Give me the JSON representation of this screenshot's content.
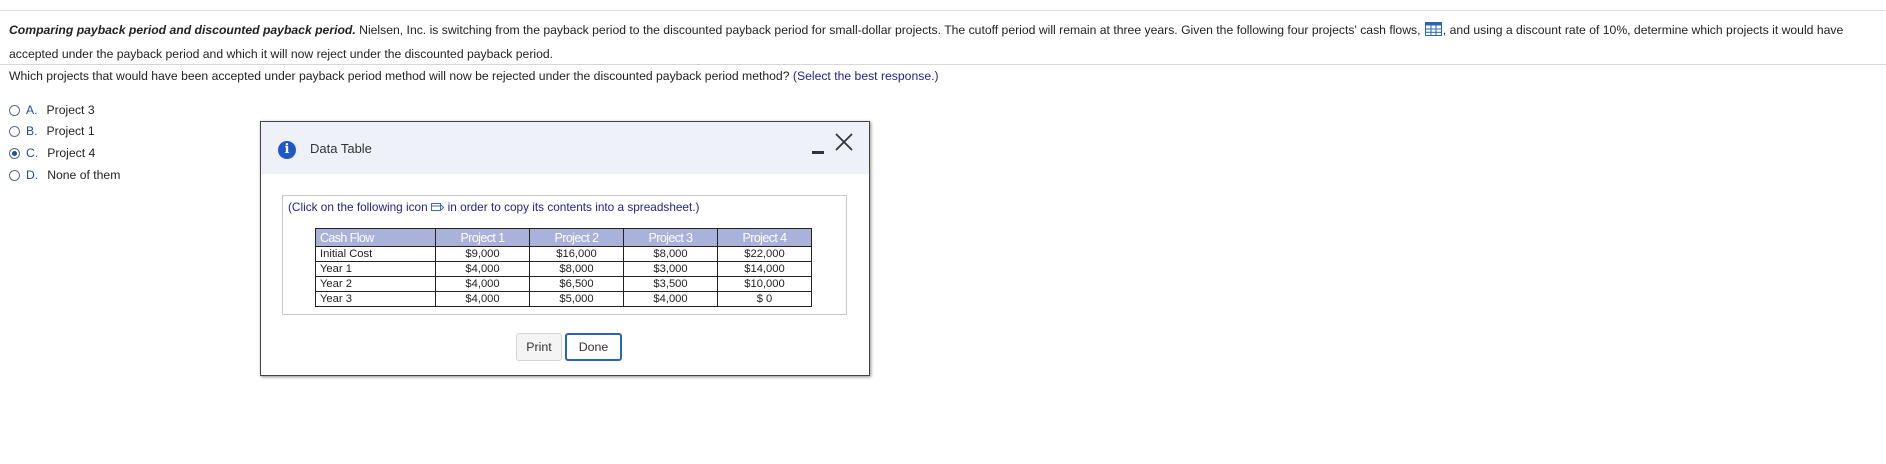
{
  "problem": {
    "lead": "Comparing payback period and discounted payback period.",
    "text_before_icon": " Nielsen, Inc. is switching from the payback period to the discounted payback period for small-dollar projects. The cutoff period will remain at three years. Given the following four projects' cash flows, ",
    "text_after_icon": ", and using a discount rate of 10%, determine which projects it would have accepted under the payback period and which it will now reject under the discounted payback period.",
    "icon": "table-grid-icon"
  },
  "question": {
    "text": "Which projects that would have been accepted under payback period method will now be rejected under the discounted payback period method?",
    "hint": "(Select the best response.)"
  },
  "options": [
    {
      "letter": "A.",
      "label": "Project 3",
      "selected": false
    },
    {
      "letter": "B.",
      "label": "Project 1",
      "selected": false
    },
    {
      "letter": "C.",
      "label": "Project 4",
      "selected": true
    },
    {
      "letter": "D.",
      "label": "None of them",
      "selected": false
    }
  ],
  "dialog": {
    "title": "Data Table",
    "copy_note_before": "(Click on the following icon",
    "copy_note_after": "in order to copy its contents into a spreadsheet.)",
    "table": {
      "headers": [
        "Cash Flow",
        "Project 1",
        "Project 2",
        "Project 3",
        "Project 4"
      ],
      "rows": [
        [
          "Initial Cost",
          "$9,000",
          "$16,000",
          "$8,000",
          "$22,000"
        ],
        [
          "Year 1",
          "$4,000",
          "$8,000",
          "$3,000",
          "$14,000"
        ],
        [
          "Year 2",
          "$4,000",
          "$6,500",
          "$3,500",
          "$10,000"
        ],
        [
          "Year 3",
          "$4,000",
          "$5,000",
          "$4,000",
          "$ 0"
        ]
      ]
    },
    "buttons": {
      "print": "Print",
      "done": "Done"
    }
  },
  "colors": {
    "accent": "#1f4e9c",
    "header_fill": "#aab2d9",
    "dialog_header": "#eef1f8",
    "info_icon": "#1f58c7",
    "hint_text": "#23238e"
  }
}
